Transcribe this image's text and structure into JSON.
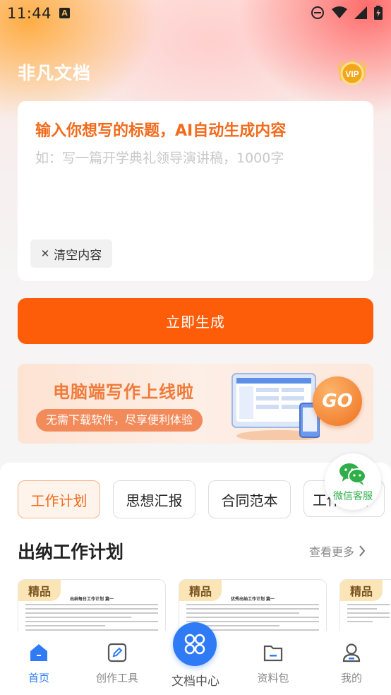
{
  "status_bar": {
    "time": "11:44",
    "notif_icon": "a-app-icon",
    "icons": [
      "do-not-disturb-icon",
      "wifi-icon",
      "signal-icon",
      "battery-charging-icon"
    ]
  },
  "header": {
    "app_title": "非凡文档",
    "vip_label": "VIP"
  },
  "input_card": {
    "title": "输入你想写的标题，AI自动生成内容",
    "placeholder": "如：写一篇开学典礼领导演讲稿，1000字",
    "clear_label": "清空内容"
  },
  "generate_button": "立即生成",
  "banner": {
    "title": "电脑端写作上线啦",
    "subtitle": "无需下载软件，尽享便利体验",
    "go_label": "GO"
  },
  "category_tabs": [
    "工作计划",
    "思想汇报",
    "合同范本",
    "工作总结"
  ],
  "active_tab": 0,
  "wechat_service": "微信客服",
  "section": {
    "title": "出纳工作计划",
    "more_label": "查看更多",
    "docs": [
      {
        "badge": "精品",
        "heading": "出纳每日工作计划 篇一"
      },
      {
        "badge": "精品",
        "heading": "优秀出纳工作计划 篇一"
      },
      {
        "badge": "精品",
        "heading": ""
      }
    ]
  },
  "bottom_nav": {
    "items": [
      {
        "label": "首页",
        "icon": "home-icon"
      },
      {
        "label": "创作工具",
        "icon": "edit-icon"
      },
      {
        "label": "资料包",
        "icon": "folder-icon"
      },
      {
        "label": "我的",
        "icon": "profile-icon"
      }
    ],
    "center": {
      "label": "文档中心",
      "icon": "grid-icon"
    }
  },
  "colors": {
    "accent": "#fd5c08",
    "title_orange": "#f26a1b",
    "nav_active": "#2f7bf6",
    "wechat_green": "#2fae4a"
  }
}
